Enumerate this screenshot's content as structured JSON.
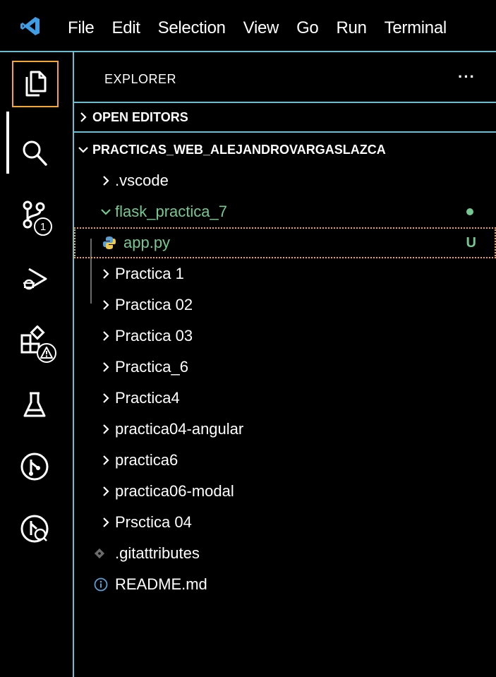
{
  "menu": [
    "File",
    "Edit",
    "Selection",
    "View",
    "Go",
    "Run",
    "Terminal"
  ],
  "activity_bar": {
    "items": [
      {
        "icon": "files-icon"
      },
      {
        "icon": "search-icon"
      },
      {
        "icon": "source-control-icon",
        "badge": "1"
      },
      {
        "icon": "run-debug-icon"
      },
      {
        "icon": "extensions-icon"
      },
      {
        "icon": "testing-icon"
      },
      {
        "icon": "git-graph-icon"
      },
      {
        "icon": "remote-explorer-icon"
      }
    ]
  },
  "explorer": {
    "title": "EXPLORER",
    "more": "···",
    "open_editors": "OPEN EDITORS",
    "root": "PRACTICAS_WEB_ALEJANDROVARGASLAZCA",
    "tree": [
      {
        "label": ".vscode",
        "type": "folder",
        "expanded": false
      },
      {
        "label": "flask_practica_7",
        "type": "folder",
        "expanded": true,
        "status": "●"
      },
      {
        "label": "app.py",
        "type": "file",
        "status": "U"
      },
      {
        "label": "Practica 1",
        "type": "folder",
        "expanded": false
      },
      {
        "label": "Practica 02",
        "type": "folder",
        "expanded": false
      },
      {
        "label": "Practica 03",
        "type": "folder",
        "expanded": false
      },
      {
        "label": "Practica_6",
        "type": "folder",
        "expanded": false
      },
      {
        "label": "Practica4",
        "type": "folder",
        "expanded": false
      },
      {
        "label": "practica04-angular",
        "type": "folder",
        "expanded": false
      },
      {
        "label": "practica6",
        "type": "folder",
        "expanded": false
      },
      {
        "label": "practica06-modal",
        "type": "folder",
        "expanded": false
      },
      {
        "label": "Prsctica 04",
        "type": "folder",
        "expanded": false
      },
      {
        "label": ".gitattributes",
        "type": "file"
      },
      {
        "label": "README.md",
        "type": "file"
      }
    ]
  },
  "colors": {
    "background": "#000000",
    "border": "#66bfd2",
    "focus": "#f4a72e",
    "untracked": "#73c991",
    "vscode_blue": "#3e9de4",
    "python": "#5a9fd4"
  }
}
